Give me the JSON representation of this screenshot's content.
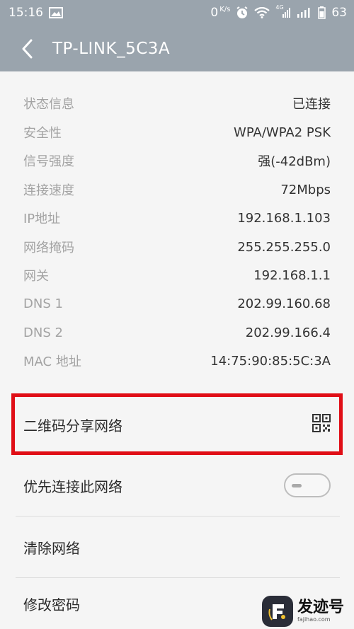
{
  "status_bar": {
    "time": "15:16",
    "net_speed": "0",
    "net_speed_unit": "K/s",
    "network_type": "4G",
    "battery": "63"
  },
  "header": {
    "title": "TP-LINK_5C3A"
  },
  "info": [
    {
      "label": "状态信息",
      "value": "已连接"
    },
    {
      "label": "安全性",
      "value": "WPA/WPA2 PSK"
    },
    {
      "label": "信号强度",
      "value": "强(-42dBm)"
    },
    {
      "label": "连接速度",
      "value": "72Mbps"
    },
    {
      "label": "IP地址",
      "value": "192.168.1.103"
    },
    {
      "label": "网络掩码",
      "value": "255.255.255.0"
    },
    {
      "label": "网关",
      "value": "192.168.1.1"
    },
    {
      "label": "DNS 1",
      "value": "202.99.160.68"
    },
    {
      "label": "DNS 2",
      "value": "202.99.166.4"
    },
    {
      "label": "MAC 地址",
      "value": "14:75:90:85:5C:3A"
    }
  ],
  "actions": {
    "qr_share": "二维码分享网络",
    "priority": "优先连接此网络",
    "priority_enabled": false,
    "forget": "清除网络",
    "change_password": "修改密码"
  },
  "watermark": {
    "name": "发迹号",
    "url": "fajihao.com"
  },
  "colors": {
    "header_bg": "#9aa4ad",
    "highlight_border": "#e00e16",
    "page_bg": "#f5f5f5"
  }
}
